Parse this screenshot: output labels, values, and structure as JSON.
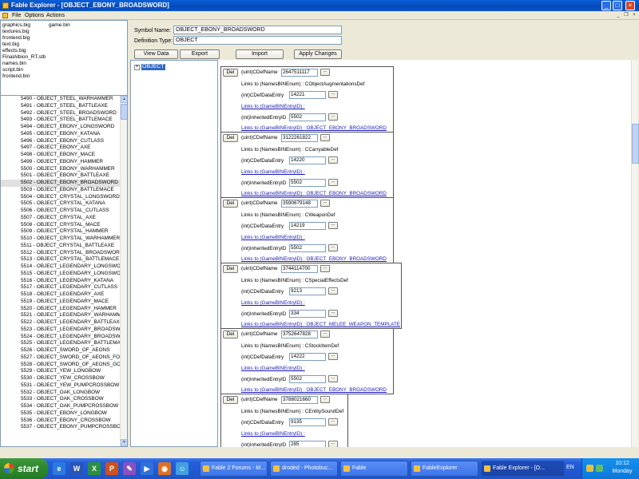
{
  "window": {
    "title": "Fable Explorer - [OBJECT_EBONY_BROADSWORD]"
  },
  "menu": {
    "items": [
      "File",
      "Options",
      "Actions"
    ]
  },
  "file_list": {
    "col1": [
      "graphics.big",
      "textures.big",
      "frontend.big",
      "text.big",
      "effects.big",
      "FinalAlbion_RT.stb",
      "names.bin",
      "script.bin",
      "frontend.bin"
    ],
    "col2": [
      "game.bin"
    ]
  },
  "tree": {
    "selected_index": 12,
    "items": [
      "5490 - OBJECT_STEEL_WARHAMMER",
      "5491 - OBJECT_STEEL_BATTLEAXE",
      "5492 - OBJECT_STEEL_BROADSWORD",
      "5493 - OBJECT_STEEL_BATTLEMACE",
      "5494 - OBJECT_EBONY_LONGSWORD",
      "5495 - OBJECT_EBONY_KATANA",
      "5496 - OBJECT_EBONY_CUTLASS",
      "5497 - OBJECT_EBONY_AXE",
      "5498 - OBJECT_EBONY_MACE",
      "5499 - OBJECT_EBONY_HAMMER",
      "5500 - OBJECT_EBONY_WARHAMMER",
      "5501 - OBJECT_EBONY_BATTLEAXE",
      "5502 - OBJECT_EBONY_BROADSWORD",
      "5503 - OBJECT_EBONY_BATTLEMACE",
      "5504 - OBJECT_CRYSTAL_LONGSWORD",
      "5505 - OBJECT_CRYSTAL_KATANA",
      "5506 - OBJECT_CRYSTAL_CUTLASS",
      "5507 - OBJECT_CRYSTAL_AXE",
      "5508 - OBJECT_CRYSTAL_MACE",
      "5509 - OBJECT_CRYSTAL_HAMMER",
      "5510 - OBJECT_CRYSTAL_WARHAMMER",
      "5511 - OBJECT_CRYSTAL_BATTLEAXE",
      "5512 - OBJECT_CRYSTAL_BROADSWORD",
      "5513 - OBJECT_CRYSTAL_BATTLEMACE",
      "5514 - OBJECT_LEGENDARY_LONGSWOR",
      "5515 - OBJECT_LEGENDARY_LONGSWOF",
      "5516 - OBJECT_LEGENDARY_KATANA",
      "5517 - OBJECT_LEGENDARY_CUTLASS",
      "5518 - OBJECT_LEGENDARY_AXE",
      "5519 - OBJECT_LEGENDARY_MACE",
      "5520 - OBJECT_LEGENDARY_HAMMER",
      "5521 - OBJECT_LEGENDARY_WARHAMMEI",
      "5522 - OBJECT_LEGENDARY_BATTLEAXE",
      "5523 - OBJECT_LEGENDARY_BROADSWC",
      "5524 - OBJECT_LEGENDARY_BROADSWC",
      "5525 - OBJECT_LEGENDARY_BATTLEMAC",
      "5526 - OBJECT_SWORD_OF_AEONS",
      "5527 - OBJECT_SWORD_OF_AEONS_FOR",
      "5528 - OBJECT_SWORD_OF_AEONS_GOO",
      "5529 - OBJECT_YEW_LONGBOW",
      "5530 - OBJECT_YEW_CROSSBOW",
      "5531 - OBJECT_YEW_PUMPCROSSBOW",
      "5532 - OBJECT_OAK_LONGBOW",
      "5533 - OBJECT_OAK_CROSSBOW",
      "5534 - OBJECT_OAK_PUMPCROSSBOW",
      "5535 - OBJECT_EBONY_LONGBOW",
      "5536 - OBJECT_EBONY_CROSSBOW",
      "5537 - OBJECT_EBONY_PUMPCROSSBOW"
    ]
  },
  "header": {
    "symbol_label": "Symbol Name:",
    "symbol_value": "OBJECT_EBONY_BROADSWORD",
    "deftype_label": "Definition Type:",
    "deftype_value": "OBJECT",
    "btn_view": "View Data",
    "btn_export": "Export",
    "btn_import": "Import",
    "btn_apply": "Apply Changes"
  },
  "object_tree": {
    "expander": "+",
    "node": "OBJECT"
  },
  "labels": {
    "del": "Del",
    "cdefname": "(uint)CDefName",
    "links_names": "Links to (NamesBINEnum) :",
    "cdefdataentry": "(int)CDefDataEntry",
    "links_game_empty": "Links to (GameBINEntryID) :",
    "inherited": "(int)InheritedEntryID",
    "links_game_prefix": "Links to (GameBINEntryID) :",
    "dots": "..."
  },
  "defs": [
    {
      "name_val": "2647511117",
      "enum": "CObjectAugmentationsDef",
      "entry": "14221",
      "inherited": "5502",
      "target": "OBJECT_EBONY_BROADSWORD"
    },
    {
      "name_val": "3122261822",
      "enum": "CCarryableDef",
      "entry": "14220",
      "inherited": "5502",
      "target": "OBJECT_EBONY_BROADSWORD"
    },
    {
      "name_val": "3590679148",
      "enum": "CWeaponDef",
      "entry": "14219",
      "inherited": "5502",
      "target": "OBJECT_EBONY_BROADSWORD"
    },
    {
      "name_val": "3744114700",
      "enum": "CSpecialEffectsDef",
      "entry": "9213",
      "inherited": "334",
      "target": "OBJECT_MELEE_WEAPON_TEMPLATE"
    },
    {
      "name_val": "3752647828",
      "enum": "CStockItemDef",
      "entry": "14222",
      "inherited": "5502",
      "target": "OBJECT_EBONY_BROADSWORD"
    },
    {
      "name_val": "3788021660",
      "enum": "CEntitySoundDef",
      "entry": "9135",
      "inherited": "285",
      "target": "OBJECT_BASE"
    }
  ],
  "taskbar": {
    "start": "start",
    "quicklaunch": [
      "ie-icon",
      "word-icon",
      "excel-icon",
      "powerpoint-icon",
      "paint-icon",
      "media-icon",
      "firefox-icon",
      "messenger-icon"
    ],
    "tasks": [
      "Fable 2 Forums - M...",
      "droded - Photobuc...",
      "Fable",
      "FableExplorer",
      "Fable Explorer - [O..."
    ],
    "lang": "EN",
    "time": "10:12",
    "day": "Monday"
  }
}
